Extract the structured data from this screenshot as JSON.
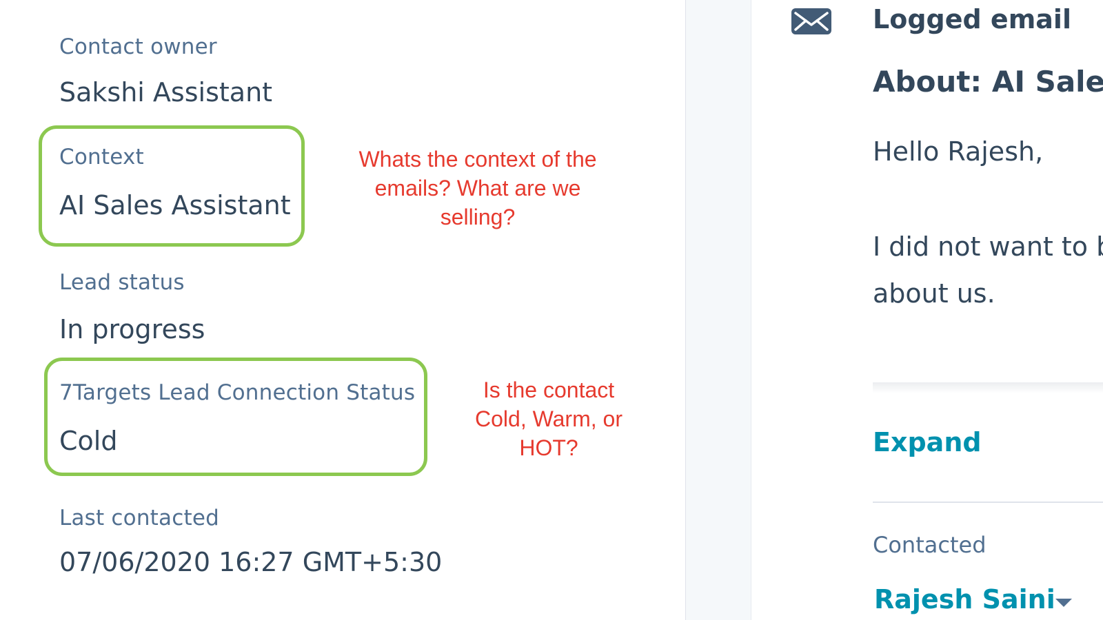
{
  "properties": {
    "contact_owner": {
      "label": "Contact owner",
      "value": "Sakshi Assistant"
    },
    "context": {
      "label": "Context",
      "value": "AI Sales Assistant"
    },
    "lead_status": {
      "label": "Lead status",
      "value": "In progress"
    },
    "connection_status": {
      "label": "7Targets Lead Connection Status",
      "value": "Cold"
    },
    "last_contacted": {
      "label": "Last contacted",
      "value": "07/06/2020 16:27 GMT+5:30"
    }
  },
  "annotations": {
    "context_note": [
      "Whats the context of the",
      "emails? What are we",
      "selling?"
    ],
    "status_note": [
      "Is the contact",
      "Cold, Warm, or",
      "HOT?"
    ]
  },
  "activity": {
    "icon": "envelope-icon",
    "title": "Logged email",
    "subject": "About: AI Sales",
    "body_lines": [
      "Hello Rajesh,",
      "I did not want to b",
      "about us."
    ],
    "expand_label": "Expand",
    "contacted_label": "Contacted",
    "contact_name": "Rajesh Saini"
  },
  "colors": {
    "highlight": "#8cc850",
    "annotation": "#e63a2e",
    "link": "#0091ae",
    "text": "#33475b",
    "label": "#516f90"
  }
}
